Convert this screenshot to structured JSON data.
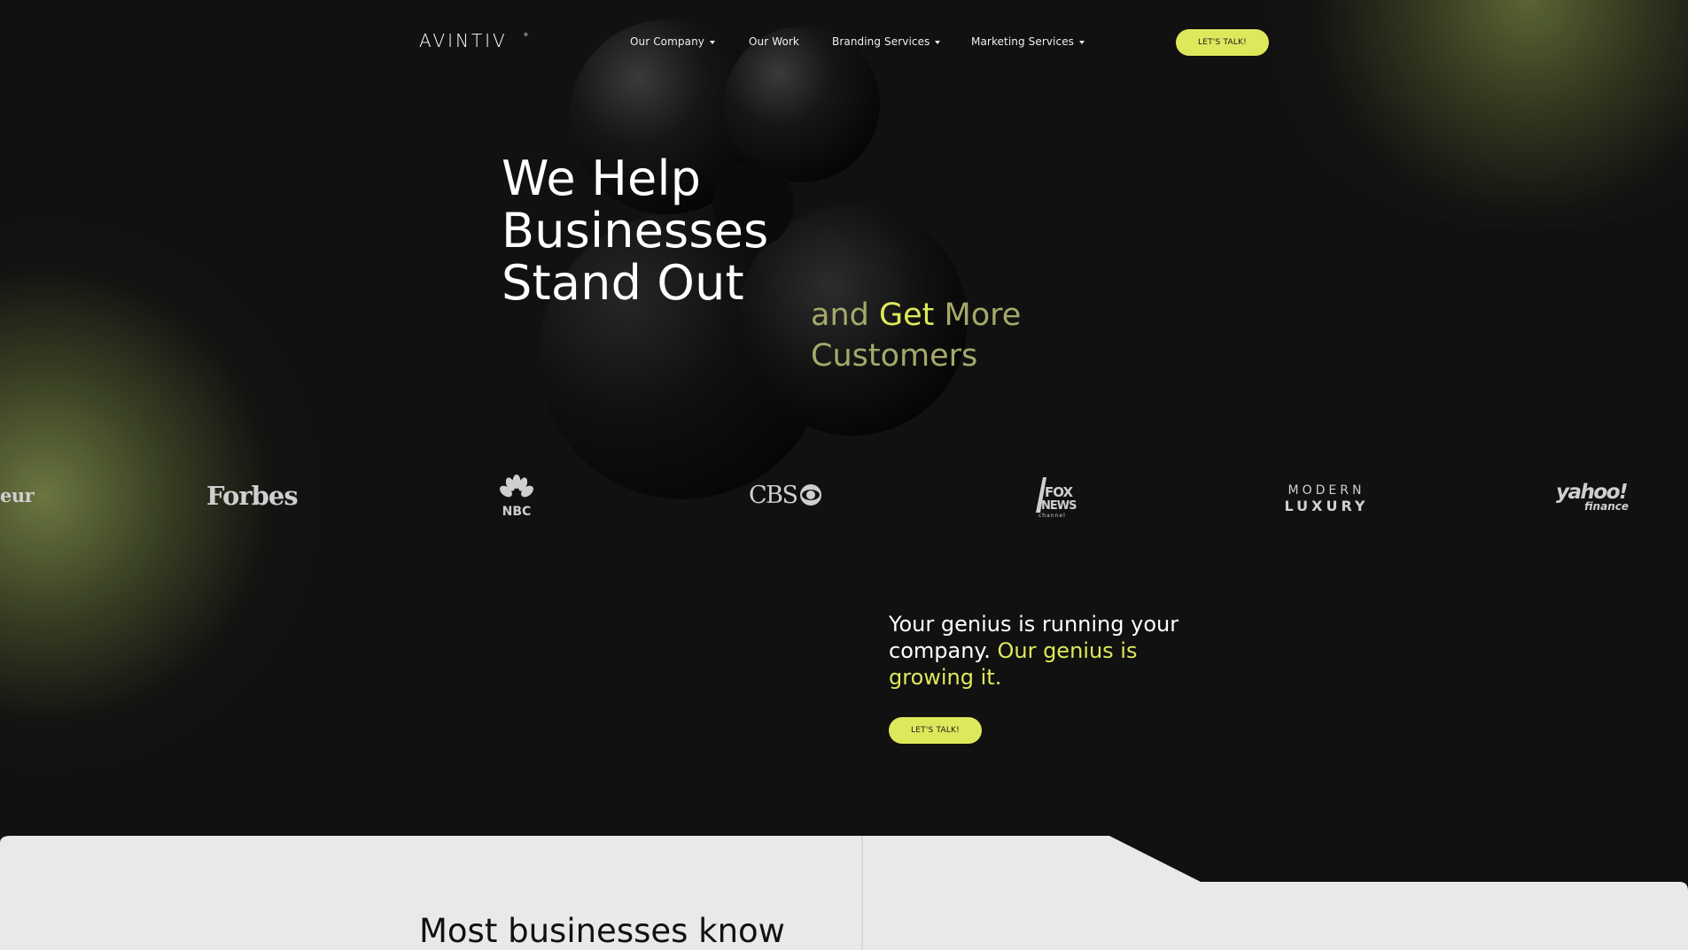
{
  "brand": {
    "logo_text": "AVINTIV",
    "logo_mark": "®"
  },
  "nav": {
    "items": [
      {
        "label": "Our Company",
        "has_dropdown": true
      },
      {
        "label": "Our Work",
        "has_dropdown": false
      },
      {
        "label": "Branding Services",
        "has_dropdown": true
      },
      {
        "label": "Marketing Services",
        "has_dropdown": true
      }
    ],
    "cta_label": "LET'S TALK!"
  },
  "hero": {
    "title_lines": [
      "We Help",
      "Businesses",
      "Stand Out"
    ],
    "sub_line1_start": "and ",
    "sub_line1_highlight": "Get",
    "sub_line1_end": " More",
    "sub_line2": "Customers"
  },
  "press": {
    "partial": "eur",
    "forbes": "Forbes",
    "nbc": "NBC",
    "cbs": "CBS",
    "fox": [
      "FOX",
      "NEWS",
      "channel"
    ],
    "modern_luxury": [
      "MODERN",
      "LUXURY"
    ],
    "yahoo": [
      "yahoo!",
      "finance"
    ]
  },
  "tagline": {
    "white": "Your genius is running your company.",
    "highlight": "Our genius is growing it.",
    "cta_label": "LET'S TALK!"
  },
  "lower": {
    "heading": "Most businesses know"
  },
  "colors": {
    "background": "#111111",
    "accent": "#dfe85b",
    "accent_muted": "#a5a96a",
    "panel": "#e9e9e9"
  }
}
